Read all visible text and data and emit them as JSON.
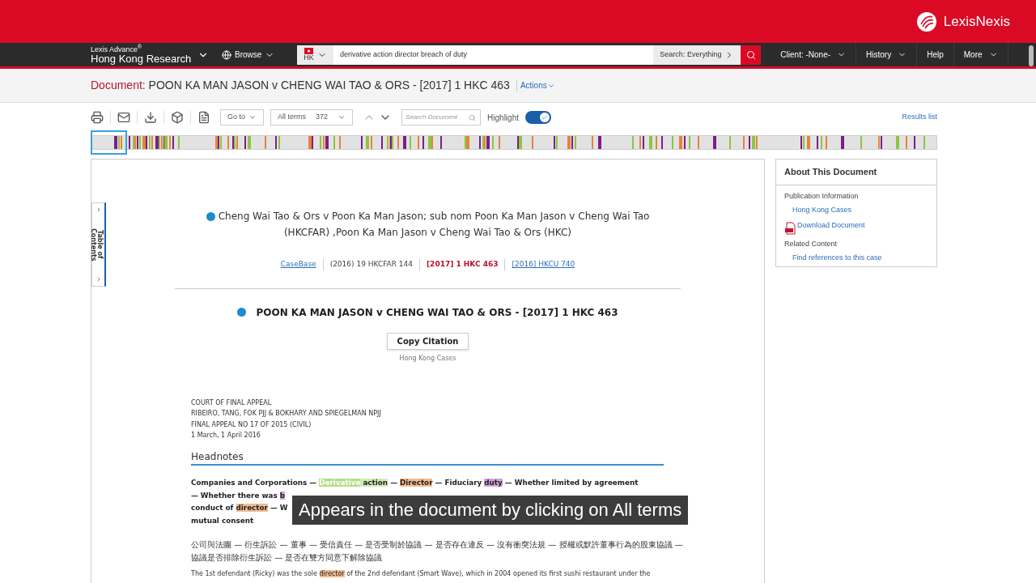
{
  "header": {
    "logo": "LexisNexis"
  },
  "nav": {
    "product": "Lexis Advance$^{®}$",
    "product_name": "Hong Kong Research",
    "browse": "Browse",
    "jurisdiction": "HK",
    "query": "derivative action director breach of duty",
    "scope": "Search: Everything",
    "menus": [
      {
        "label": "Client: -None-",
        "caret": true
      },
      {
        "label": "History",
        "caret": true
      },
      {
        "label": "Help",
        "caret": false
      },
      {
        "label": "More",
        "caret": true
      }
    ]
  },
  "doc_header": {
    "label": "Document:",
    "title": "POON KA MAN JASON v CHENG WAI TAO & ORS - [2017] 1 HKC 463",
    "actions": "Actions"
  },
  "toolbar": {
    "goto": "Go to",
    "terms_label": "All terms",
    "terms_count": "372",
    "search_placeholder": "Search Document",
    "highlight": {
      "label": "Highlight",
      "on": true
    },
    "results_link": "Results list"
  },
  "toc_tab": "Table of Contents",
  "document": {
    "parallel_title": "Cheng Wai Tao & Ors v Poon Ka Man Jason; sub nom Poon Ka Man Jason v Cheng Wai Tao (HKCFAR) ,Poon Ka Man Jason v Cheng Wai Tao & Ors (HKC)",
    "citations": [
      {
        "text": "CaseBase",
        "kind": "link"
      },
      {
        "text": "(2016) 19 HKCFAR 144",
        "kind": "plain"
      },
      {
        "text": "[2017] 1 HKC 463",
        "kind": "current"
      },
      {
        "text": "[2016] HKCU 740",
        "kind": "link"
      }
    ],
    "case_title": "POON KA MAN JASON v CHENG WAI TAO & ORS - [2017] 1 HKC 463",
    "copy_button": "Copy Citation",
    "source": "Hong Kong Cases",
    "court_lines": [
      "COURT OF FINAL APPEAL",
      "RIBEIRO, TANG, FOK PJJ & BOKHARY AND SPIEGELMAN NPJJ",
      "FINAL APPEAL NO 17 OF 2015 (CIVIL)",
      "1 March, 1 April 2016"
    ],
    "headnotes_heading": "Headnotes",
    "headnote_lines": [
      [
        {
          "text": "Companies and Corporations — "
        },
        {
          "text": "Derivative",
          "color": "#b3dd8a",
          "current": true
        },
        {
          "text": " action",
          "color": "#d3ebb8",
          "current": false
        },
        {
          "text": " — "
        },
        {
          "text": "Director",
          "color": "#f2bb92",
          "current": false
        },
        {
          "text": " — Fiduciary "
        },
        {
          "text": "duty",
          "color": "#cfa6dc",
          "current": false
        },
        {
          "text": " — Whether limited by agreement"
        }
      ],
      [
        {
          "text": "— Whether there was "
        },
        {
          "text": "b",
          "color": "#cfa6dc",
          "current": false
        }
      ],
      [
        {
          "text": "conduct of "
        },
        {
          "text": "director",
          "color": "#f2bb92",
          "current": false
        },
        {
          "text": " — W"
        }
      ],
      [
        {
          "text": "mutual consent"
        }
      ]
    ],
    "chinese_lines": [
      "公司與法團 — 衍生訴訟 — 董事 — 受信責任 — 是否受制於協議 — 是否存在違反 — 沒有衝突法規 — 授權或默許董事行為的股東協議 —",
      "協議是否排除衍生訴訟 — 是否在雙方同意下解除協議"
    ],
    "paragraph": [
      {
        "text": "The 1st defendant (Ricky) was the sole "
      },
      {
        "text": "director",
        "color": "#f2bb92",
        "current": false
      },
      {
        "text": " of the 2nd defendant (Smart Wave), which in 2004 opened its first sushi restaurant under the"
      }
    ]
  },
  "sidebar": {
    "title": "About This Document",
    "sections": [
      {
        "heading": "Publication Information",
        "items": [
          {
            "text": "Hong Kong Cases",
            "kind": "link"
          },
          {
            "text": "Download Document",
            "kind": "download"
          }
        ]
      },
      {
        "heading": "Related Content",
        "items": [
          {
            "text": "Find references to this case",
            "kind": "link"
          }
        ]
      }
    ]
  },
  "caption": "Appears in the document by clicking on All terms"
}
